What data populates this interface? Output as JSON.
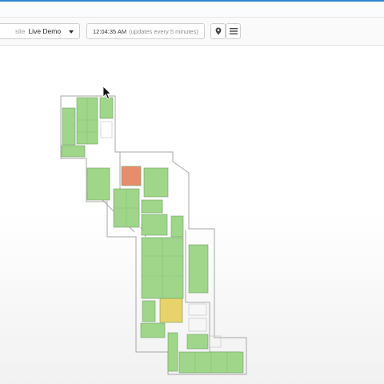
{
  "toolbar": {
    "site_prefix": "site",
    "site_value": "Live Demo",
    "time": "12:04:35 AM",
    "update_note": "(updates every 5 minutes)"
  },
  "icons": {
    "pin": "map-pin-icon",
    "menu": "hamburger-menu-icon",
    "caret": "chevron-down-icon"
  },
  "colors": {
    "accent": "#2e86d6",
    "available": "#9fd68a",
    "occupied": "#e98c6b",
    "partial": "#e7d36a"
  },
  "floorplan": {
    "zones": [
      {
        "id": "z1",
        "status": "available"
      },
      {
        "id": "z2",
        "status": "available"
      },
      {
        "id": "z3",
        "status": "available"
      },
      {
        "id": "z4",
        "status": "available"
      },
      {
        "id": "z5",
        "status": "available"
      },
      {
        "id": "z6",
        "status": "available"
      },
      {
        "id": "z7",
        "status": "occupied"
      },
      {
        "id": "z8",
        "status": "available"
      },
      {
        "id": "z9",
        "status": "available"
      },
      {
        "id": "z10",
        "status": "available"
      },
      {
        "id": "z11",
        "status": "available"
      },
      {
        "id": "z12",
        "status": "available"
      },
      {
        "id": "z13",
        "status": "available"
      },
      {
        "id": "z14",
        "status": "available"
      },
      {
        "id": "z15",
        "status": "available"
      },
      {
        "id": "z16",
        "status": "partial"
      },
      {
        "id": "z17",
        "status": "available"
      },
      {
        "id": "z18",
        "status": "available"
      },
      {
        "id": "z19",
        "status": "available"
      }
    ]
  }
}
